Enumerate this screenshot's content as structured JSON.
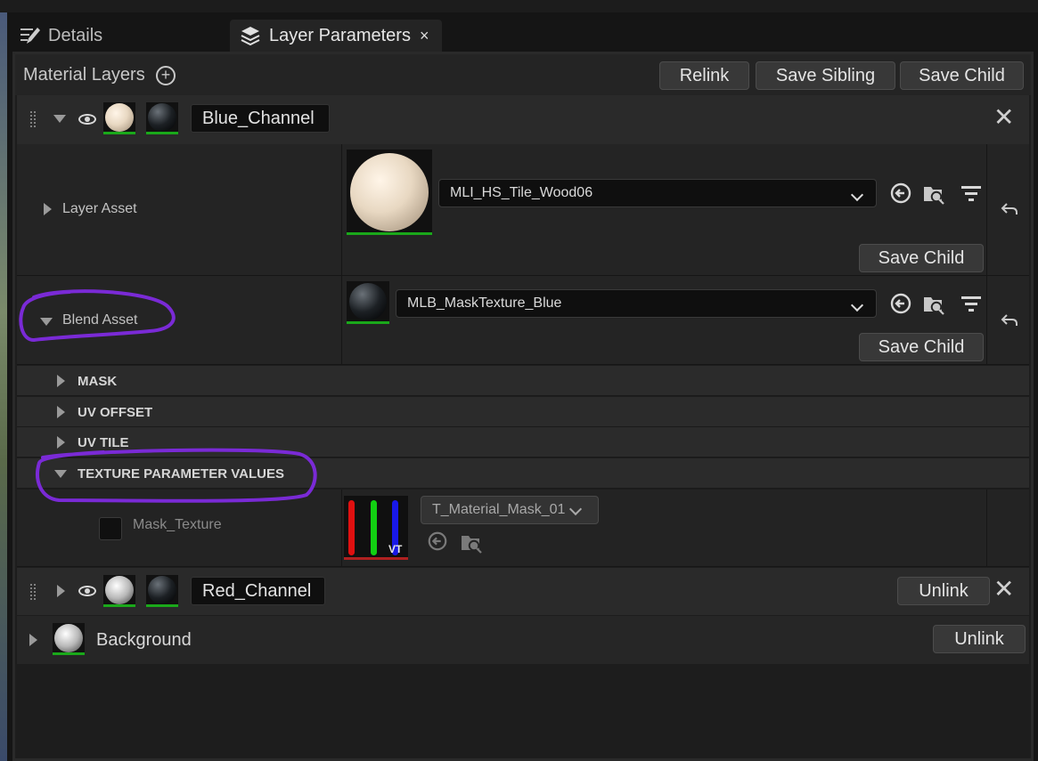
{
  "tabs": [
    {
      "label": "Details",
      "icon": "pencil-edit-icon",
      "active": false
    },
    {
      "label": "Layer Parameters",
      "icon": "layers-icon",
      "active": true,
      "close": "×"
    }
  ],
  "header": {
    "title": "Material Layers",
    "add_icon": "add-circle-icon",
    "buttons": [
      "Relink",
      "Save Sibling",
      "Save Child"
    ]
  },
  "layers": [
    {
      "name": "Blue_Channel",
      "expanded": true,
      "visible": true
    },
    {
      "name": "Red_Channel",
      "expanded": false,
      "visible": true,
      "unlink_label": "Unlink"
    }
  ],
  "blue_channel": {
    "layer_asset": {
      "label": "Layer Asset",
      "value": "MLI_HS_Tile_Wood06",
      "save_label": "Save Child"
    },
    "blend_asset": {
      "label": "Blend Asset",
      "value": "MLB_MaskTexture_Blue",
      "save_label": "Save Child"
    },
    "categories": [
      "MASK",
      "UV OFFSET",
      "UV TILE",
      "TEXTURE PARAMETER VALUES"
    ],
    "texture_param": {
      "label": "Mask_Texture",
      "value": "T_Material_Mask_01",
      "thumb_badge": "VT",
      "checked": false
    }
  },
  "background": {
    "label": "Background",
    "unlink_label": "Unlink"
  },
  "colors": {
    "panel_bg": "#1d1d1d",
    "row_bg": "#242424",
    "thumb_underline": "#1aa81a",
    "annotation": "#7a2ad6"
  }
}
